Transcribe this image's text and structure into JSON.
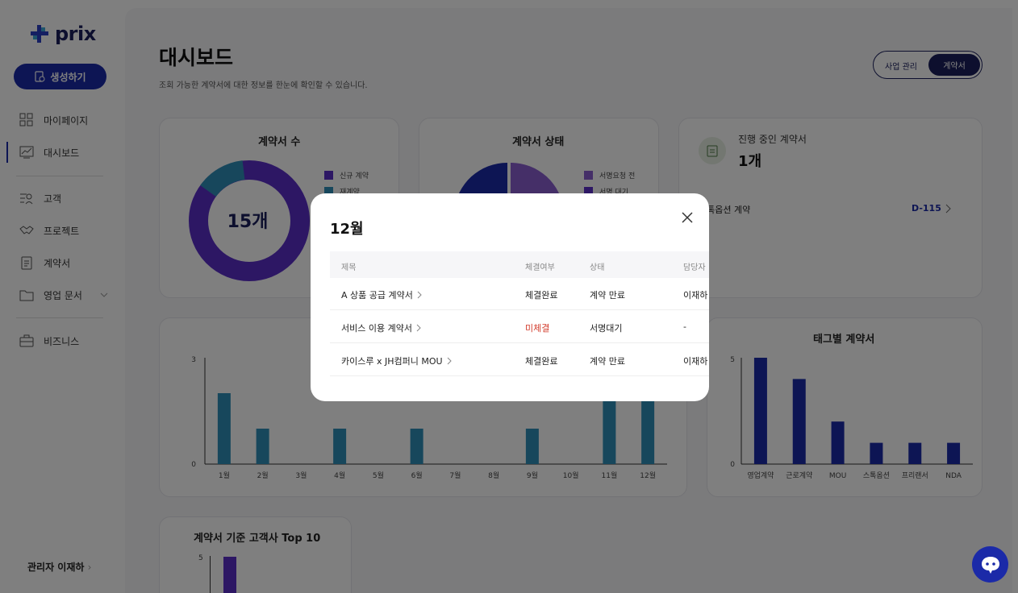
{
  "sidebar": {
    "logo_text": "prix",
    "create_label": "생성하기",
    "items": [
      {
        "label": "마이페이지",
        "icon": "grid-icon"
      },
      {
        "label": "대시보드",
        "icon": "chart-icon"
      },
      {
        "label": "고객",
        "icon": "people-icon"
      },
      {
        "label": "프로젝트",
        "icon": "handshake-icon"
      },
      {
        "label": "계약서",
        "icon": "document-icon"
      },
      {
        "label": "영업 문서",
        "icon": "folder-icon"
      },
      {
        "label": "비즈니스",
        "icon": "briefcase-icon"
      }
    ],
    "admin_label": "관리자 이재하"
  },
  "header": {
    "title": "대시보드",
    "subtitle": "조회 가능한 계약서에 대한 정보를 한눈에 확인할 수 있습니다.",
    "toggle": {
      "option1": "사업 관리",
      "option2": "계약서"
    }
  },
  "cards": {
    "count": {
      "title": "계약서 수",
      "center": "15개",
      "legend": [
        "신규 계약",
        "재계약"
      ]
    },
    "status": {
      "title": "계약서 상태",
      "legend": [
        "서명요청 전",
        "서명 대기"
      ]
    },
    "progress": {
      "title": "진행 중인 계약서",
      "count": "1개",
      "item": "스톡옵션 계약",
      "dday": "D-115"
    },
    "monthly": {
      "y_ticks": [
        "3",
        "0"
      ]
    },
    "tags": {
      "title": "태그별 계약서",
      "y_ticks": [
        "5",
        "0"
      ]
    },
    "top10": {
      "title": "계약서 기준 고객사 Top 10",
      "y_tick": "5"
    }
  },
  "chart_data": [
    {
      "type": "bar",
      "categories": [
        "1월",
        "2월",
        "3월",
        "4월",
        "5월",
        "6월",
        "7월",
        "8월",
        "9월",
        "10월",
        "11월",
        "12월"
      ],
      "values": [
        2,
        1,
        0,
        1,
        0,
        1,
        0,
        0,
        1,
        0,
        3,
        3
      ],
      "ylim": [
        0,
        3
      ],
      "color": "#2e8fb8"
    },
    {
      "type": "bar",
      "title": "태그별 계약서",
      "categories": [
        "영업계약",
        "근로계약",
        "MOU",
        "스톡옵션",
        "프리랜서",
        "NDA"
      ],
      "values": [
        5,
        4,
        2,
        1,
        1,
        1
      ],
      "ylim": [
        0,
        5
      ],
      "color": "#1b2aa8"
    }
  ],
  "modal": {
    "title": "12월",
    "headers": [
      "제목",
      "체결여부",
      "상태",
      "담당자"
    ],
    "rows": [
      {
        "title": "A 상품 공급 계약서",
        "signed": "체결완료",
        "status": "계약 만료",
        "owner": "이재하"
      },
      {
        "title": "서비스 이용 계약서",
        "signed": "미체결",
        "status": "서명대기",
        "owner": "-"
      },
      {
        "title": "카이스루 x JH컴퍼니 MOU",
        "signed": "체결완료",
        "status": "계약 만료",
        "owner": "이재하"
      }
    ]
  },
  "colors": {
    "primary": "#1b2aa8",
    "purple": "#5b2fc9",
    "teal": "#2e8fb8",
    "lavender": "#8a5fd1",
    "unsigned": "#d23b2b"
  }
}
